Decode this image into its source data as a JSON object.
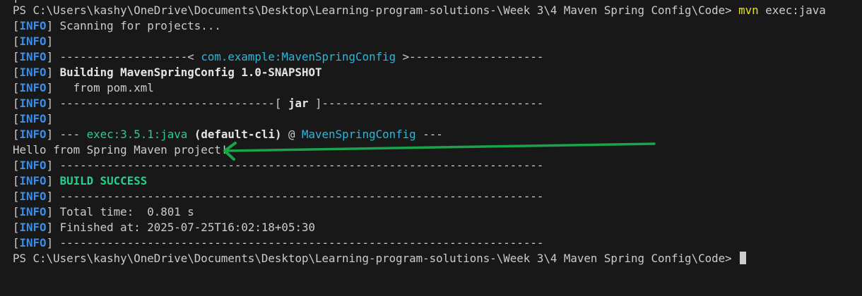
{
  "terminal": {
    "partial_top": "[",
    "lines": [
      {
        "kind": "prompt",
        "prompt": "PS C:\\Users\\kashy\\OneDrive\\Documents\\Desktop\\Learning-program-solutions-\\Week 3\\4 Maven Spring Config\\Code> ",
        "command": "mvn",
        "args": " exec:java"
      },
      {
        "kind": "info",
        "text": " Scanning for projects..."
      },
      {
        "kind": "info",
        "text": ""
      },
      {
        "kind": "info",
        "pre": " -------------------< ",
        "artifact": "com.example:MavenSpringConfig",
        "post": " >--------------------"
      },
      {
        "kind": "info",
        "bold": " Building MavenSpringConfig 1.0-SNAPSHOT"
      },
      {
        "kind": "info",
        "text": "   from pom.xml"
      },
      {
        "kind": "info",
        "pre": " --------------------------------[ ",
        "boldmid": "jar",
        "post": " ]---------------------------------"
      },
      {
        "kind": "info",
        "text": ""
      },
      {
        "kind": "info",
        "pre": " --- ",
        "plugin": "exec:3.5.1:java",
        "boldmid": " (default-cli)",
        "post": " @ ",
        "artifact2": "MavenSpringConfig",
        "post2": " ---"
      },
      {
        "kind": "plain",
        "text": "Hello from Spring Maven project!"
      },
      {
        "kind": "info",
        "text": " ------------------------------------------------------------------------"
      },
      {
        "kind": "info",
        "success": " BUILD SUCCESS"
      },
      {
        "kind": "info",
        "text": " ------------------------------------------------------------------------"
      },
      {
        "kind": "info",
        "text": " Total time:  0.801 s"
      },
      {
        "kind": "info",
        "text": " Finished at: 2025-07-25T16:02:18+05:30"
      },
      {
        "kind": "info",
        "text": " ------------------------------------------------------------------------"
      },
      {
        "kind": "prompt_final",
        "prompt": "PS C:\\Users\\kashy\\OneDrive\\Documents\\Desktop\\Learning-program-solutions-\\Week 3\\4 Maven Spring Config\\Code> "
      }
    ],
    "info_word": "INFO"
  },
  "colors": {
    "background": "#181818",
    "text": "#cccccc",
    "info": "#3b8eea",
    "command": "#e5e510",
    "artifact": "#29b8db",
    "plugin": "#23d18b",
    "success": "#23d18b",
    "annotation_arrow": "#1aa34a"
  },
  "annotation": {
    "icon": "arrow-left-icon"
  }
}
